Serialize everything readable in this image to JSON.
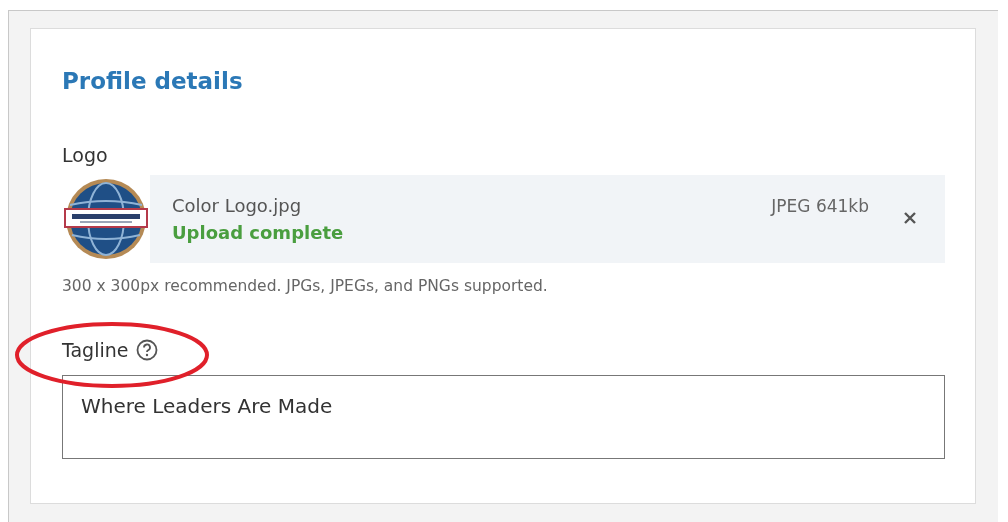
{
  "section": {
    "title": "Profile details"
  },
  "logo": {
    "label": "Logo",
    "file_name": "Color Logo.jpg",
    "status": "Upload complete",
    "file_info": "JPEG 641kb",
    "hint": "300 x 300px recommended. JPGs, JPEGs, and PNGs supported."
  },
  "tagline": {
    "label": "Tagline",
    "value": "Where Leaders Are Made"
  }
}
